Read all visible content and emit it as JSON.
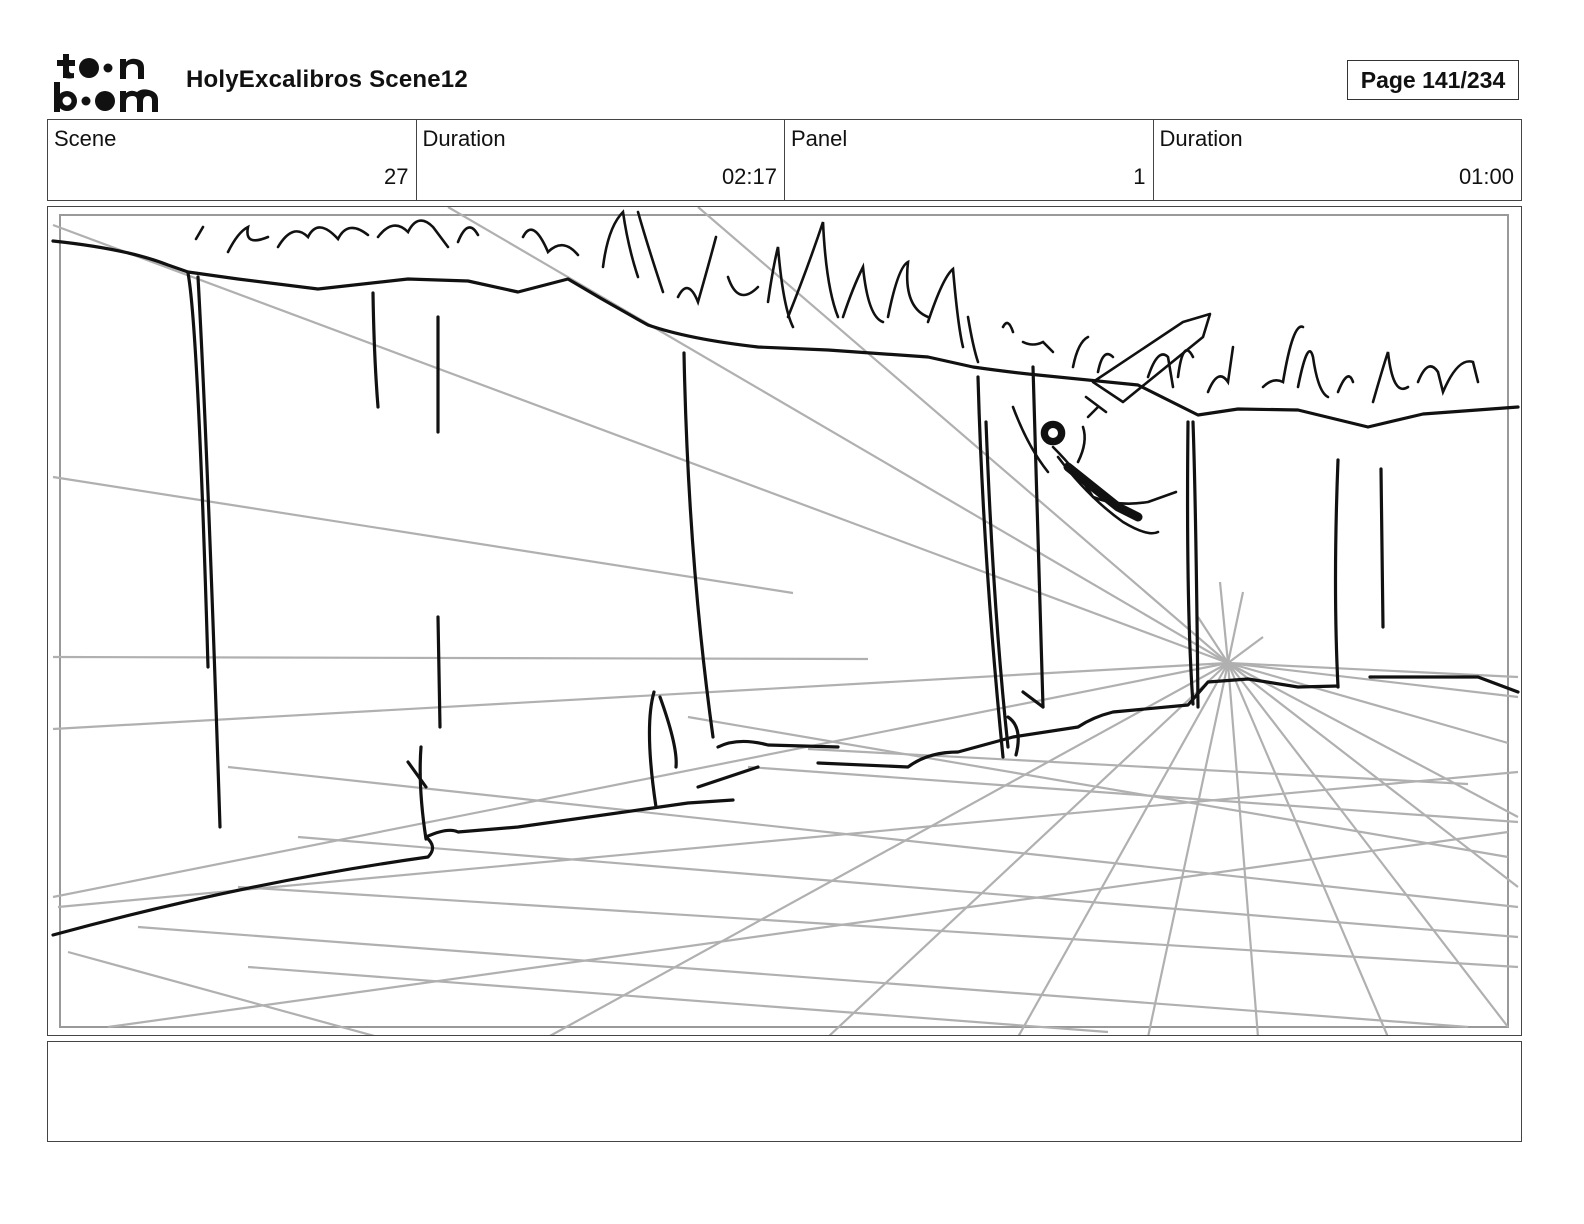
{
  "header": {
    "logo": {
      "line1": "toon",
      "line2": "boom"
    },
    "title": "HolyExcalibros Scene12",
    "page": "Page 141/234"
  },
  "info": {
    "scene_label": "Scene",
    "scene_value": "27",
    "scene_duration_label": "Duration",
    "scene_duration_value": "02:17",
    "panel_label": "Panel",
    "panel_value": "1",
    "panel_duration_label": "Duration",
    "panel_duration_value": "01:00"
  },
  "notes": {
    "text": ""
  }
}
